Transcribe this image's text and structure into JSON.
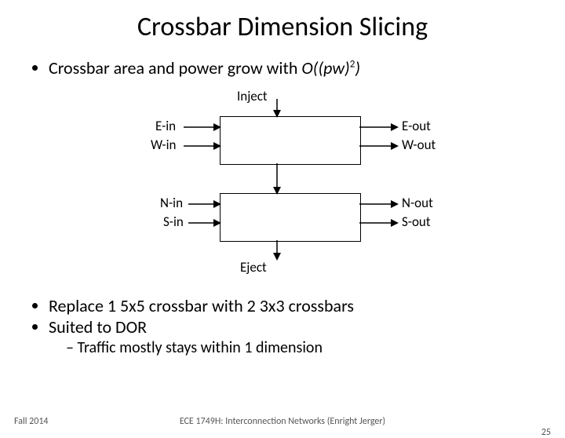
{
  "title": "Crossbar Dimension Slicing",
  "bullet1_prefix": "Crossbar area and power grow with ",
  "bullet1_expr_O": "O((pw)",
  "bullet1_expr_sup": "2",
  "bullet1_expr_tail": ")",
  "labels": {
    "inject": "Inject",
    "eject": "Eject",
    "ein": "E-in",
    "win": "W-in",
    "nin": "N-in",
    "sin": "S-in",
    "eout": "E-out",
    "wout": "W-out",
    "nout": "N-out",
    "sout": "S-out"
  },
  "bullet2": "Replace 1 5x5 crossbar with 2 3x3 crossbars",
  "bullet3": "Suited to DOR",
  "bullet3a": "Traffic mostly stays within 1 dimension",
  "footer": {
    "left": "Fall 2014",
    "center": "ECE 1749H: Interconnection Networks (Enright Jerger)",
    "right": "25"
  }
}
